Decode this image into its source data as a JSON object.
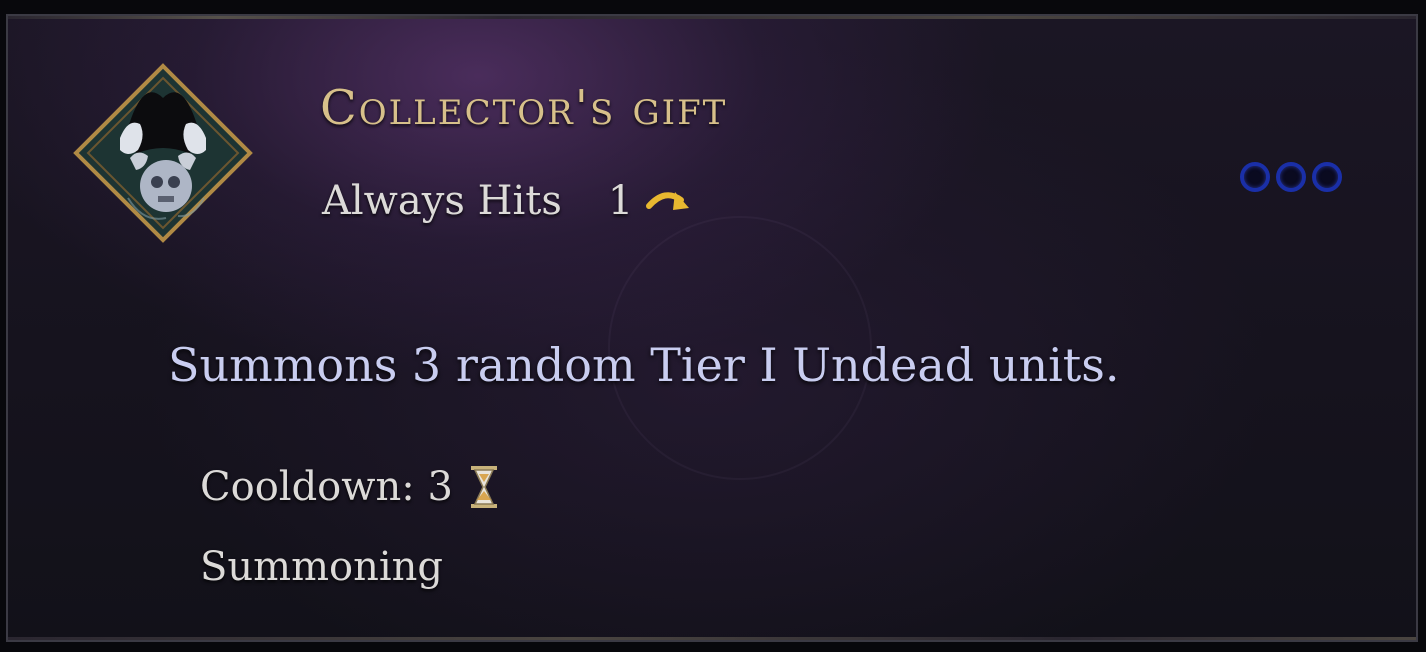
{
  "ability": {
    "title": "Collector's gift",
    "hit_type": "Always Hits",
    "charges": "1",
    "charges_icon": "curved-arrow-icon",
    "icon": "ghost-skull-hands-icon",
    "ability_points": 3,
    "ability_points_color": "#1a2fa8",
    "description": "Summons 3 random Tier I Undead units.",
    "cooldown_label": "Cooldown: 3",
    "cooldown_icon": "hourglass-icon",
    "category": "Summoning"
  },
  "colors": {
    "title": "#d7c08a",
    "description": "#c9cdf0",
    "text": "#dcdad8",
    "arrow": "#e8b830"
  }
}
